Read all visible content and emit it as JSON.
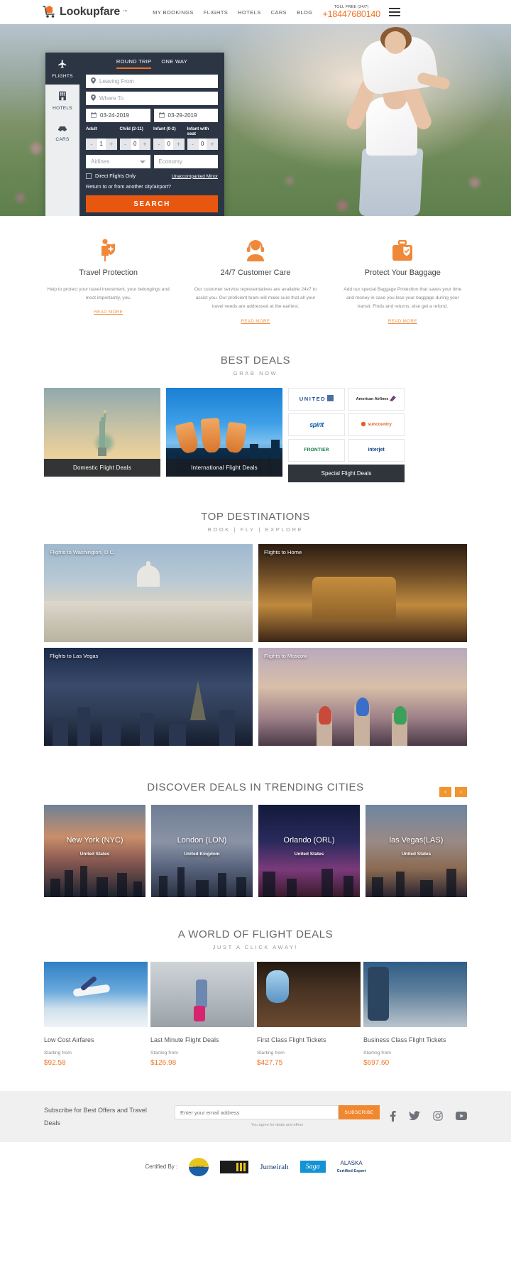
{
  "header": {
    "logo_text": "Lookupfare",
    "logo_tm": "™",
    "nav": [
      {
        "label": "MY BOOKINGS"
      },
      {
        "label": "FLIGHTS"
      },
      {
        "label": "HOTELS"
      },
      {
        "label": "CARS"
      },
      {
        "label": "BLOG"
      }
    ],
    "toll_free_label": "TOLL FREE (24/7)",
    "phone": "+18447680140"
  },
  "search": {
    "vertical_tabs": [
      {
        "label": "FLIGHTS",
        "icon": "airplane-icon",
        "active": true
      },
      {
        "label": "HOTELS",
        "icon": "building-icon",
        "active": false
      },
      {
        "label": "CARS",
        "icon": "car-icon",
        "active": false
      }
    ],
    "trip_tabs": [
      {
        "label": "ROUND TRIP",
        "active": true
      },
      {
        "label": "ONE WAY",
        "active": false
      }
    ],
    "leaving_from_placeholder": "Leaving From",
    "where_to_placeholder": "Where To",
    "depart_date": "03-24-2019",
    "return_date": "03-29-2019",
    "pax": [
      {
        "label": "Adult",
        "value": "1"
      },
      {
        "label": "Child (2-11)",
        "value": "0"
      },
      {
        "label": "Infant (0-2)",
        "value": "0"
      },
      {
        "label": "Infant with seat",
        "value": "0"
      }
    ],
    "minus": "-",
    "plus": "+",
    "airlines_value": "Airlines",
    "cabin_value": "Economy",
    "direct_flights_label": "Direct Flights Only",
    "unaccompanied_minor_label": "Unaccompanied Minor",
    "return_other_city_label": "Return to or from another city/airport?",
    "search_button": "SEARCH"
  },
  "features": [
    {
      "icon": "travel-protection-icon",
      "title": "Travel Protection",
      "desc": "Help to protect your travel investment, your belongings and most importantly, you.",
      "link": "READ MORE"
    },
    {
      "icon": "headset-support-icon",
      "title": "24/7 Customer Care",
      "desc": "Our customer service representatives are available 24x7 to assist you. Our proficient team will make sure that all your travel needs are addressed at the earliest.",
      "link": "READ MORE"
    },
    {
      "icon": "baggage-protection-icon",
      "title": "Protect Your Baggage",
      "desc": "Add our special Baggage Protection that saves your time and money in case you lose your baggage during your transit. Finds and returns, else get a refund.",
      "link": "READ MORE"
    }
  ],
  "best_deals": {
    "title": "BEST DEALS",
    "subtitle": "GRAB NOW",
    "cards": [
      {
        "label": "Domestic Flight Deals",
        "image": "statue-of-liberty"
      },
      {
        "label": "International Flight Deals",
        "image": "singapore-artscience-museum"
      }
    ],
    "special_label": "Special Flight Deals",
    "airline_logos": [
      {
        "name": "UNITED"
      },
      {
        "name": "American Airlines"
      },
      {
        "name": "spirit"
      },
      {
        "name": "suncountry"
      },
      {
        "name": "FRONTIER"
      },
      {
        "name": "interjet"
      }
    ]
  },
  "top_destinations": {
    "title": "TOP DESTINATIONS",
    "subtitle": "BOOK | FLY | EXPLORE",
    "items": [
      {
        "label": "Flights to Washington, D.C.",
        "image": "us-capitol"
      },
      {
        "label": "Flights to Home",
        "image": "colosseum"
      },
      {
        "label": "Flights to Las Vegas",
        "image": "las-vegas-strip"
      },
      {
        "label": "Flights to Moscow",
        "image": "st-basils-cathedral"
      }
    ]
  },
  "trending": {
    "title": "DISCOVER DEALS IN TRENDING CITIES",
    "prev": "‹",
    "next": "›",
    "cities": [
      {
        "name": "New York (NYC)",
        "country": "United States"
      },
      {
        "name": "London (LON)",
        "country": "United Kingdom"
      },
      {
        "name": "Orlando (ORL)",
        "country": "United States"
      },
      {
        "name": "las Vegas(LAS)",
        "country": "United States"
      }
    ]
  },
  "world_deals": {
    "title": "A WORLD OF FLIGHT DEALS",
    "subtitle": "JUST A CLICK AWAY!",
    "starting_from_label": "Starting from",
    "items": [
      {
        "title": "Low Cost Airfares",
        "price": "$92.58"
      },
      {
        "title": "Last Minute Flight Deals",
        "price": "$126.98"
      },
      {
        "title": "First Class Flight Tickets",
        "price": "$427.75"
      },
      {
        "title": "Business Class Flight Tickets",
        "price": "$697.60"
      }
    ]
  },
  "subscribe": {
    "text": "Subscribe for Best Offers and Travel Deals",
    "placeholder": "Enter your email address",
    "button": "SUBSCRIBE",
    "note": "You agree for deals and offers",
    "socials": [
      {
        "name": "facebook-icon",
        "glyph": "f"
      },
      {
        "name": "twitter-icon",
        "glyph": "🐦"
      },
      {
        "name": "instagram-icon",
        "glyph": "◻"
      },
      {
        "name": "youtube-icon",
        "glyph": "▶"
      }
    ]
  },
  "certified": {
    "label": "Certified By :",
    "logos": [
      {
        "name": "travel-expert-badge",
        "text": "EXPERT"
      },
      {
        "name": "tag-logo",
        "text": ""
      },
      {
        "name": "jumeirah-logo",
        "text": "Jumeirah"
      },
      {
        "name": "saga-logo",
        "text": "Saga"
      },
      {
        "name": "alaska-certified-expert-logo",
        "text": "ALASKA"
      },
      {
        "name": "alaska-sub",
        "text": "Certified Expert"
      }
    ]
  },
  "colors": {
    "accent": "#f37021",
    "accent_dark": "#e8570f",
    "panel": "#2c3544"
  }
}
